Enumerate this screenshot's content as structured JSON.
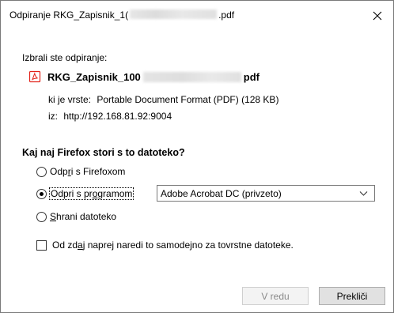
{
  "window": {
    "title_prefix": "Odpiranje RKG_Zapisnik_1(",
    "title_suffix": ".pdf",
    "close_glyph": "✕"
  },
  "dialog": {
    "chosen_label": "Izbrali ste odpiranje:",
    "file_name_prefix": "RKG_Zapisnik_100",
    "file_name_suffix": "pdf",
    "file_icon": "pdf-file-icon",
    "type_label": "ki je vrste:",
    "type_value": "Portable Document Format (PDF) (128 KB)",
    "from_label": "iz:",
    "from_value": "http://192.168.81.92:9004",
    "question": "Kaj naj Firefox stori s to datoteko?",
    "options": {
      "open_firefox": {
        "before": "Odp",
        "underlined": "r",
        "after": "i s Firefoxom",
        "selected": false
      },
      "open_with": {
        "before": "Odpri s pr",
        "underlined": "o",
        "after": "gramom",
        "selected": true
      },
      "save": {
        "before": "",
        "underlined": "S",
        "after": "hrani datoteko",
        "selected": false
      }
    },
    "program_select_value": "Adobe Acrobat DC (privzeto)",
    "remember": {
      "before": "Od zd",
      "underlined": "a",
      "after": "j naprej naredi to samodejno za tovrstne datoteke.",
      "checked": false
    },
    "ok_label": "V redu",
    "cancel_label": "Prekliči"
  },
  "colors": {
    "pdf_red": "#e2231a",
    "disabled_text": "#8a8a8a"
  }
}
